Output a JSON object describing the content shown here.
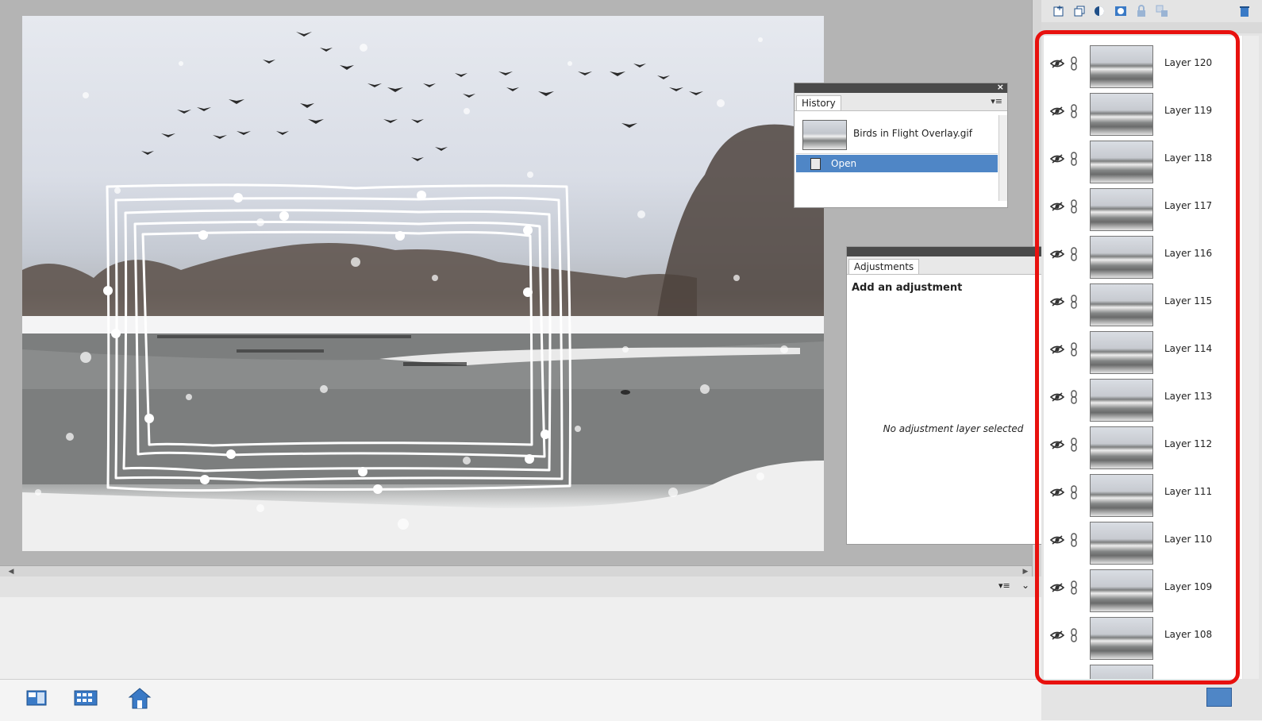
{
  "history": {
    "tab": "History",
    "items": [
      {
        "label": "Birds in Flight Overlay.gif"
      },
      {
        "label": "Open"
      }
    ]
  },
  "adjustments": {
    "tab": "Adjustments",
    "heading": "Add an adjustment",
    "empty_text": "No adjustment layer selected"
  },
  "layers": {
    "items": [
      {
        "name": "Layer 120"
      },
      {
        "name": "Layer 119"
      },
      {
        "name": "Layer 118"
      },
      {
        "name": "Layer 117"
      },
      {
        "name": "Layer 116"
      },
      {
        "name": "Layer 115"
      },
      {
        "name": "Layer 114"
      },
      {
        "name": "Layer 113"
      },
      {
        "name": "Layer 112"
      },
      {
        "name": "Layer 111"
      },
      {
        "name": "Layer 110"
      },
      {
        "name": "Layer 109"
      },
      {
        "name": "Layer 108"
      }
    ]
  },
  "icons": {
    "close": "close-icon",
    "panel_menu": "panel-menu-icon",
    "visibility": "eye-hidden-icon",
    "link": "link-icon",
    "home": "home-icon",
    "delete": "trash-icon"
  },
  "colors": {
    "selection": "#4f86c6",
    "highlight": "#e8110e"
  }
}
